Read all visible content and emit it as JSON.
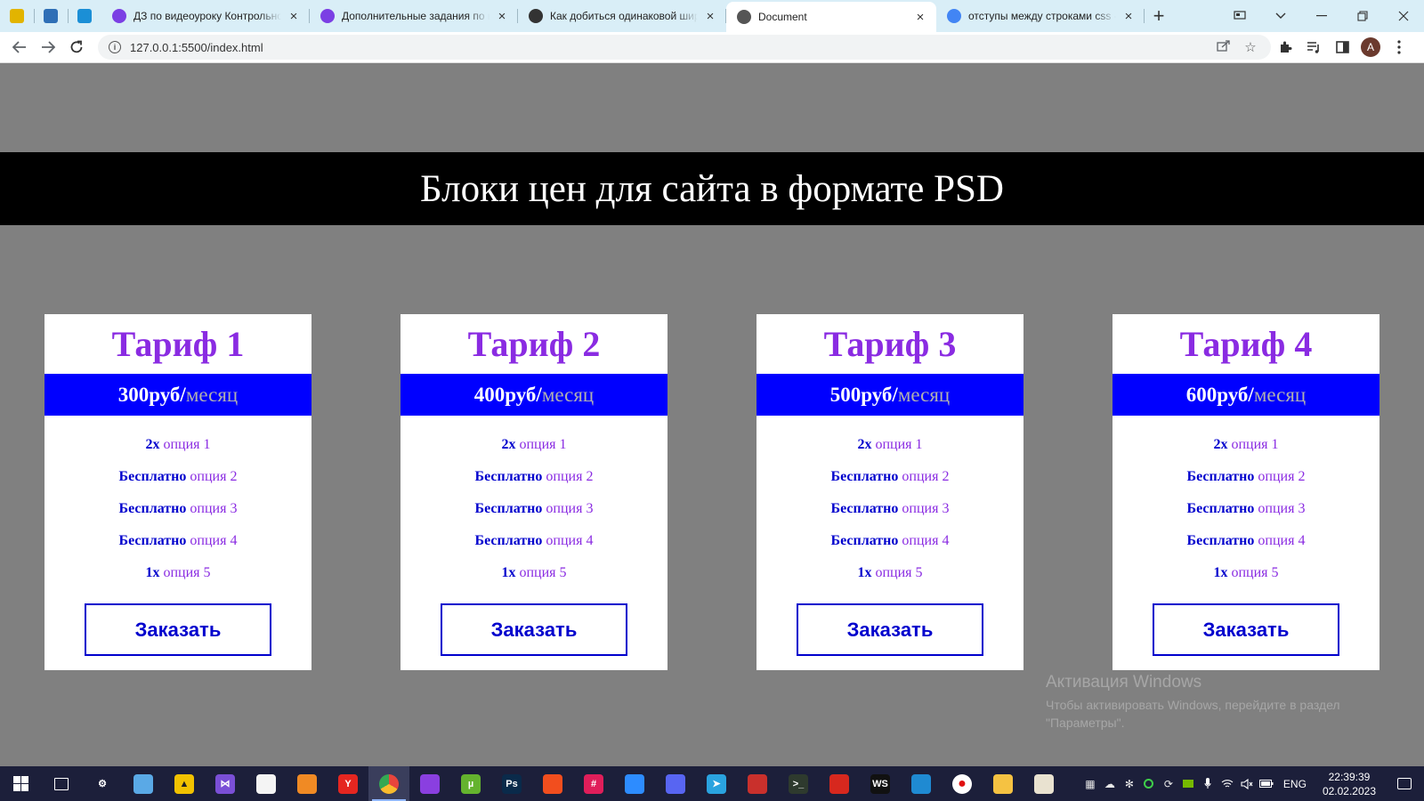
{
  "browser": {
    "pinned_tabs": [
      {
        "icon": "yellow-app-icon",
        "color": "#e2b400"
      },
      {
        "icon": "atom-icon",
        "color": "#2f6fb6"
      },
      {
        "icon": "monitor-app-icon",
        "color": "#1b8fd6"
      }
    ],
    "tabs": [
      {
        "title": "ДЗ по видеоуроку Контрольное",
        "icon": "it-icon",
        "color": "#7b3fe4",
        "active": false
      },
      {
        "title": "Дополнительные задания по ви",
        "icon": "it-icon",
        "color": "#7b3fe4",
        "active": false
      },
      {
        "title": "Как добиться одинаковой шири",
        "icon": "stack-icon",
        "color": "#333333",
        "active": false
      },
      {
        "title": "Document",
        "icon": "globe-icon",
        "color": "#555555",
        "active": true
      },
      {
        "title": "отступы между строками css - П",
        "icon": "google-icon",
        "color": "#4285f4",
        "active": false
      }
    ],
    "url": "127.0.0.1:5500/index.html",
    "profile_initial": "A"
  },
  "page": {
    "heading": "Блоки цен для сайта в формате PSD",
    "cards": [
      {
        "title": "Тариф 1",
        "price": "300руб/",
        "period": "месяц",
        "options": [
          {
            "qty": "2x",
            "name": "опция 1"
          },
          {
            "qty": "Бесплатно",
            "name": "опция 2"
          },
          {
            "qty": "Бесплатно",
            "name": "опция 3"
          },
          {
            "qty": "Бесплатно",
            "name": "опция 4"
          },
          {
            "qty": "1x",
            "name": "опция 5"
          }
        ],
        "button": "Заказать"
      },
      {
        "title": "Тариф 2",
        "price": "400руб/",
        "period": "месяц",
        "options": [
          {
            "qty": "2x",
            "name": "опция 1"
          },
          {
            "qty": "Бесплатно",
            "name": "опция 2"
          },
          {
            "qty": "Бесплатно",
            "name": "опция 3"
          },
          {
            "qty": "Бесплатно",
            "name": "опция 4"
          },
          {
            "qty": "1x",
            "name": "опция 5"
          }
        ],
        "button": "Заказать"
      },
      {
        "title": "Тариф 3",
        "price": "500руб/",
        "period": "месяц",
        "options": [
          {
            "qty": "2x",
            "name": "опция 1"
          },
          {
            "qty": "Бесплатно",
            "name": "опция 2"
          },
          {
            "qty": "Бесплатно",
            "name": "опция 3"
          },
          {
            "qty": "Бесплатно",
            "name": "опция 4"
          },
          {
            "qty": "1x",
            "name": "опция 5"
          }
        ],
        "button": "Заказать"
      },
      {
        "title": "Тариф 4",
        "price": "600руб/",
        "period": "месяц",
        "options": [
          {
            "qty": "2x",
            "name": "опция 1"
          },
          {
            "qty": "Бесплатно",
            "name": "опция 2"
          },
          {
            "qty": "Бесплатно",
            "name": "опция 3"
          },
          {
            "qty": "Бесплатно",
            "name": "опция 4"
          },
          {
            "qty": "1x",
            "name": "опция 5"
          }
        ],
        "button": "Заказать"
      }
    ]
  },
  "watermark": {
    "title": "Активация Windows",
    "text": "Чтобы активировать Windows, перейдите в раздел \"Параметры\"."
  },
  "taskbar": {
    "apps": [
      {
        "name": "task-view-icon",
        "label": "",
        "color": "transparent"
      },
      {
        "name": "settings-gear-icon",
        "label": "⚙",
        "color": "transparent"
      },
      {
        "name": "notepad-icon",
        "label": "",
        "color": "#5aa9e6"
      },
      {
        "name": "aimp-icon",
        "label": "▲",
        "color": "#f2c200"
      },
      {
        "name": "visual-studio-icon",
        "label": "⋈",
        "color": "#7a4fd6"
      },
      {
        "name": "file-editor-icon",
        "label": "",
        "color": "#f4f4f4"
      },
      {
        "name": "paint-icon",
        "label": "",
        "color": "#f08a24"
      },
      {
        "name": "yandex-browser-icon",
        "label": "Y",
        "color": "#e52620"
      },
      {
        "name": "chrome-icon",
        "label": "",
        "color": "#e8453c"
      },
      {
        "name": "podcast-icon",
        "label": "",
        "color": "#8a3fe0"
      },
      {
        "name": "utorrent-icon",
        "label": "µ",
        "color": "#64b32e"
      },
      {
        "name": "photoshop-icon",
        "label": "Ps",
        "color": "#0a2a4a"
      },
      {
        "name": "figma-icon",
        "label": "",
        "color": "#f24e1e"
      },
      {
        "name": "slack-icon",
        "label": "#",
        "color": "#e01e5a"
      },
      {
        "name": "zoom-icon",
        "label": "",
        "color": "#2d8cff"
      },
      {
        "name": "discord-icon",
        "label": "",
        "color": "#5865f2"
      },
      {
        "name": "telegram-icon",
        "label": "➤",
        "color": "#2aa3df"
      },
      {
        "name": "filezilla-icon",
        "label": "",
        "color": "#c9302c"
      },
      {
        "name": "terminal-icon",
        "label": ">_",
        "color": "#2e3a2e"
      },
      {
        "name": "acrobat-icon",
        "label": "",
        "color": "#d7281e"
      },
      {
        "name": "webstorm-icon",
        "label": "WS",
        "color": "#111111"
      },
      {
        "name": "vscode-icon",
        "label": "",
        "color": "#1f8ad2"
      },
      {
        "name": "recorder-icon",
        "label": "●",
        "color": "#ffffff"
      },
      {
        "name": "file-explorer-icon",
        "label": "",
        "color": "#f5c242"
      },
      {
        "name": "paint-palette-icon",
        "label": "",
        "color": "#e9e2d0"
      }
    ],
    "active_app": 8,
    "lang": "ENG",
    "time": "22:39:39",
    "date": "02.02.2023"
  },
  "colors": {
    "page_bg": "#808080",
    "banner_bg": "#000000",
    "price_bar": "#0000ff",
    "title_purple": "#8a2be2",
    "accent_blue": "#0000cd"
  }
}
